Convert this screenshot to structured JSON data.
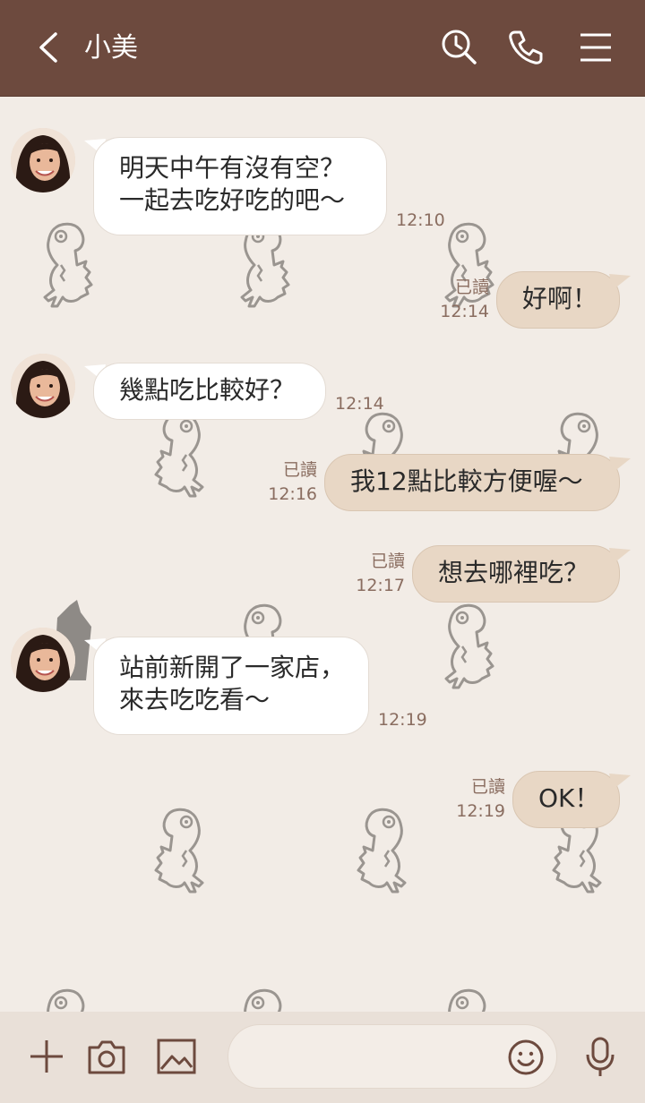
{
  "header": {
    "back_icon": "chevron-left-icon",
    "title": "小美",
    "icons": [
      "search-clock-icon",
      "phone-icon",
      "menu-icon"
    ],
    "background": "#6d4a3e"
  },
  "messages": [
    {
      "direction": "in",
      "lines": [
        "明天中午有沒有空？",
        "一起去吃好吃的吧～"
      ],
      "time": "12:10"
    },
    {
      "direction": "out",
      "lines": [
        "好啊！"
      ],
      "read": "已讀",
      "time": "12:14"
    },
    {
      "direction": "in",
      "lines": [
        "幾點吃比較好？"
      ],
      "time": "12:14"
    },
    {
      "direction": "out",
      "lines": [
        "我12點比較方便喔～"
      ],
      "read": "已讀",
      "time": "12:16"
    },
    {
      "direction": "out",
      "lines": [
        "想去哪裡吃？"
      ],
      "read": "已讀",
      "time": "12:17"
    },
    {
      "direction": "in",
      "lines": [
        "站前新開了一家店，",
        "來去吃吃看～"
      ],
      "time": "12:19"
    },
    {
      "direction": "out",
      "lines": [
        "OK！"
      ],
      "read": "已讀",
      "time": "12:19"
    }
  ],
  "footer": {
    "icons": [
      "plus-icon",
      "camera-icon",
      "image-icon",
      "emoji-icon",
      "microphone-icon"
    ],
    "input_placeholder": ""
  },
  "colors": {
    "chat_background": "#f2ece6",
    "incoming_bubble": "#ffffff",
    "outgoing_bubble": "#e8d7c5",
    "meta_text": "#8a6d60"
  }
}
